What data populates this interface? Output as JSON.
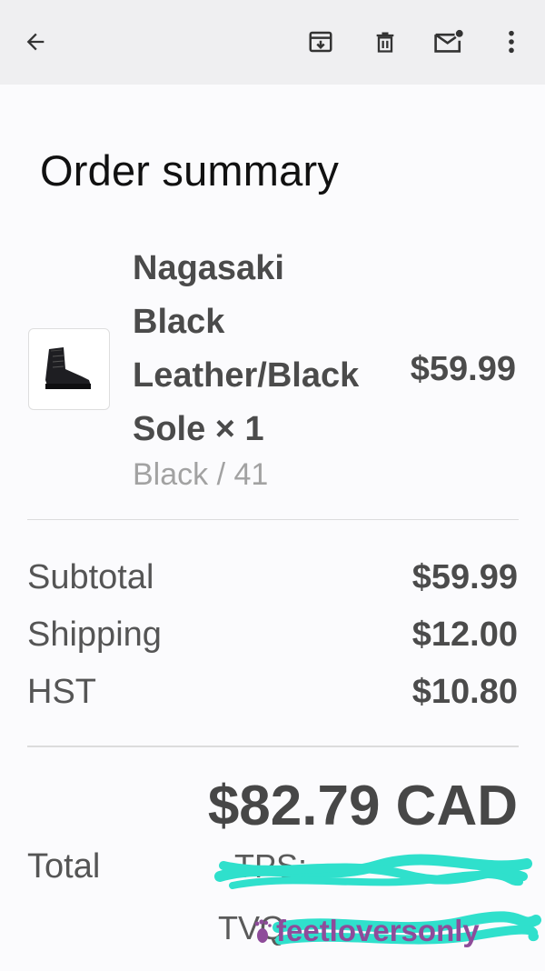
{
  "toolbar": {
    "back_icon": "arrow-left-icon",
    "archive_icon": "archive-icon",
    "delete_icon": "trash-icon",
    "unread_icon": "mail-unread-icon",
    "more_icon": "more-vertical-icon"
  },
  "page": {
    "title": "Order summary"
  },
  "line_item": {
    "name_lines": [
      "Nagasaki",
      "Black",
      "Leather/Black",
      "Sole × 1"
    ],
    "variant": "Black / 41",
    "price": "$59.99",
    "image": "black-leather-boot-thumbnail"
  },
  "summary": {
    "rows": [
      {
        "label": "Subtotal",
        "value": "$59.99"
      },
      {
        "label": "Shipping",
        "value": "$12.00"
      },
      {
        "label": "HST",
        "value": "$10.80"
      }
    ],
    "total_label": "Total",
    "total_value": "$82.79 CAD",
    "tax_lines_obscured": [
      "TPS: ...",
      "TVQ: ..."
    ]
  },
  "watermark": {
    "text": "feetloversonly",
    "color": "#8e4c9a"
  },
  "colors": {
    "scribble": "#2fe0cc",
    "topbar": "#efeff1"
  }
}
